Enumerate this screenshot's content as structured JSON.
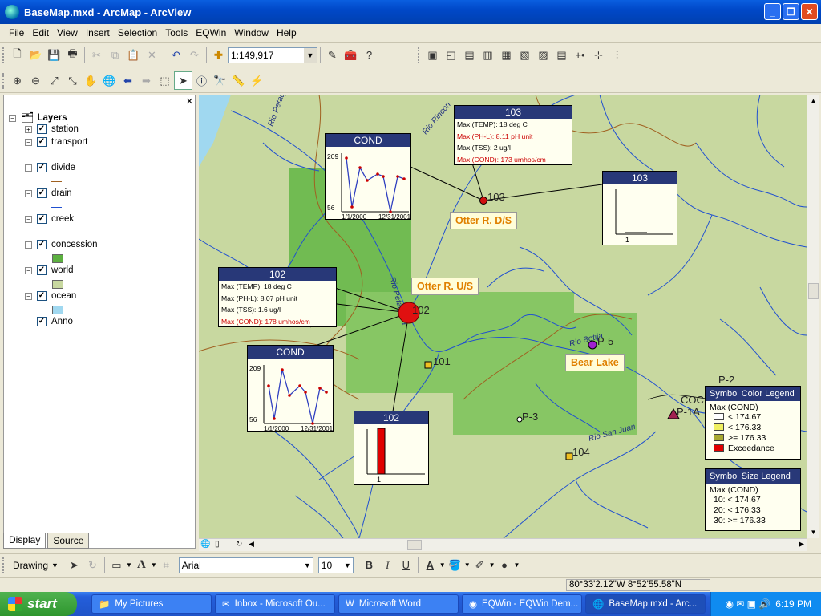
{
  "window": {
    "title": "BaseMap.mxd - ArcMap - ArcView"
  },
  "menu": [
    "File",
    "Edit",
    "View",
    "Insert",
    "Selection",
    "Tools",
    "EQWin",
    "Window",
    "Help"
  ],
  "toolbar": {
    "scale": "1:149,917"
  },
  "toc": {
    "root": "Layers",
    "layers": [
      "station",
      "transport",
      "divide",
      "drain",
      "creek",
      "concession",
      "world",
      "ocean",
      "Anno"
    ],
    "tabs": [
      "Display",
      "Source"
    ]
  },
  "map": {
    "rivers": [
      "Rio Petaquilla",
      "Rio Rincon",
      "Rio Petaquilla",
      "Rio Botija",
      "Rio San Juan"
    ],
    "stations": {
      "s103": "103",
      "s102": "102",
      "s101": "101",
      "s104": "104",
      "p3": "P-3",
      "p5": "P-5",
      "p2": "P-2",
      "p1a": "P-1A",
      "coc": "COC"
    },
    "labels": {
      "otter_ds": "Otter R. D/S",
      "otter_us": "Otter R. U/S",
      "bear_lake": "Bear Lake"
    },
    "popup103": {
      "title": "103",
      "rows": [
        "Max (TEMP): 18 deg C",
        "Max (PH-L): 8.11 pH unit",
        "Max (TSS): 2 ug/l",
        "Max (COND): 173 umhos/cm"
      ]
    },
    "popup102": {
      "title": "102",
      "rows": [
        "Max (TEMP): 18 deg C",
        "Max (PH-L): 8.07 pH unit",
        "Max (TSS): 1.6 ug/l",
        "Max (COND): 178 umhos/cm"
      ]
    },
    "chart_cond1": {
      "title": "COND",
      "ymax": "209",
      "ymin": "56",
      "x0": "1/1/2000",
      "x1": "12/31/2001"
    },
    "chart_cond2": {
      "title": "COND",
      "ymax": "209",
      "ymin": "56",
      "x0": "1/1/2000",
      "x1": "12/31/2001"
    },
    "chart_103bar": {
      "title": "103",
      "xtick": "1"
    },
    "chart_102bar": {
      "title": "102",
      "xtick": "1"
    },
    "colorLegend": {
      "title": "Symbol Color Legend",
      "sub": "Max (COND)",
      "items": [
        {
          "label": "< 174.67",
          "color": "#ffffff"
        },
        {
          "label": "< 176.33",
          "color": "#f0f060"
        },
        {
          "label": ">= 176.33",
          "color": "#a8a830"
        },
        {
          "label": "Exceedance",
          "color": "#e00000"
        }
      ]
    },
    "sizeLegend": {
      "title": "Symbol Size Legend",
      "sub": "Max (COND)",
      "items": [
        "10:  < 174.67",
        "20:  < 176.33",
        "30:  >=  176.33"
      ]
    }
  },
  "drawing": {
    "label": "Drawing",
    "font": "Arial",
    "size": "10"
  },
  "status": {
    "coords": "80°33'2.12\"W  8°52'55.58\"N"
  },
  "taskbar": {
    "start": "start",
    "tasks": [
      "My Pictures",
      "Inbox - Microsoft Ou...",
      "Microsoft Word",
      "EQWin - EQWin Dem...",
      "BaseMap.mxd - Arc..."
    ],
    "time": "6:19 PM"
  }
}
